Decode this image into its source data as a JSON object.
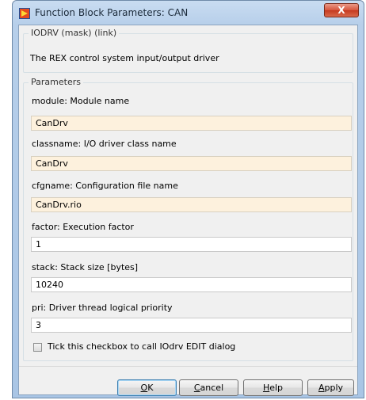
{
  "window": {
    "title": "Function Block Parameters: CAN",
    "close_label": "X"
  },
  "mask_group": {
    "legend": "IODRV (mask) (link)",
    "description": "The REX control system input/output driver"
  },
  "params_group": {
    "legend": "Parameters"
  },
  "params": {
    "module": {
      "label": "module: Module name",
      "value": "CanDrv"
    },
    "classname": {
      "label": "classname: I/O driver class name",
      "value": "CanDrv"
    },
    "cfgname": {
      "label": "cfgname: Configuration file name",
      "value": "CanDrv.rio"
    },
    "factor": {
      "label": "factor: Execution factor",
      "value": "1"
    },
    "stack": {
      "label": "stack: Stack size [bytes]",
      "value": "10240"
    },
    "pri": {
      "label": "pri: Driver thread logical priority",
      "value": "3"
    }
  },
  "edit_checkbox": {
    "label": "Tick this checkbox to call IOdrv EDIT dialog",
    "checked": false
  },
  "buttons": {
    "ok": {
      "mnemonic": "O",
      "rest": "K"
    },
    "cancel": {
      "mnemonic": "C",
      "rest": "ancel"
    },
    "help": {
      "mnemonic": "H",
      "rest": "elp"
    },
    "apply": {
      "mnemonic": "A",
      "rest": "pply"
    }
  },
  "colors": {
    "mask_field_bg": "#fdf1dd",
    "close_button": "#c53a20",
    "default_button_border": "#3c7fb1"
  },
  "icons": {
    "window_icon": "simulink-block-icon",
    "close_icon": "close-x-icon"
  }
}
